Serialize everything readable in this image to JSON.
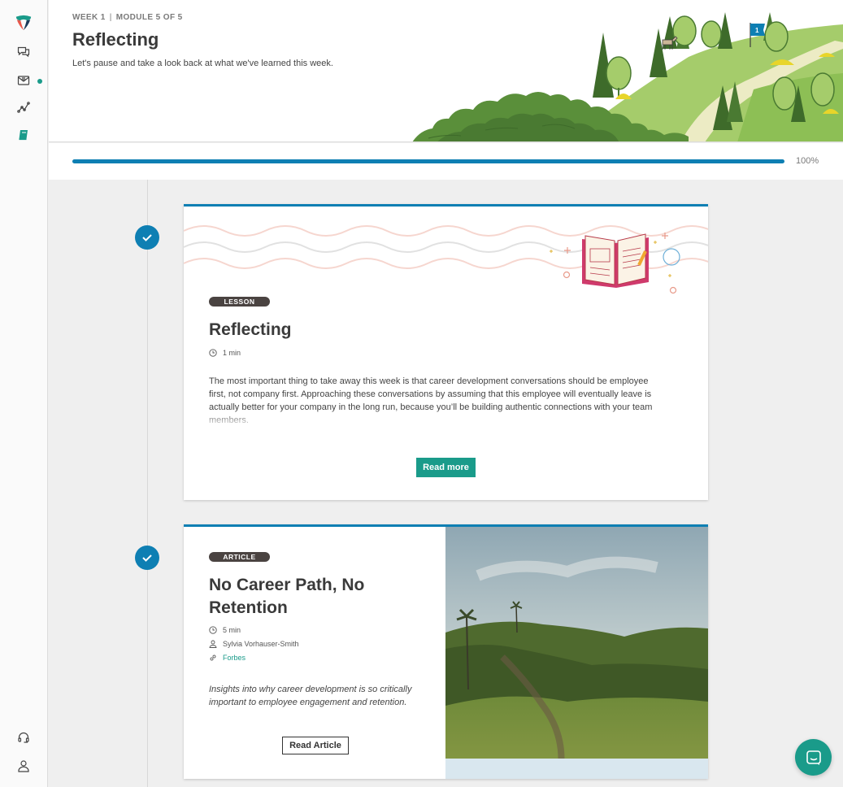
{
  "sidebar": {
    "icons": [
      "logo-icon",
      "chat-bubbles-icon",
      "inbox-icon",
      "analytics-icon",
      "book-icon",
      "headset-icon",
      "user-icon"
    ],
    "accent_color": "#1a9b8a"
  },
  "header": {
    "week": "WEEK 1",
    "separator": "|",
    "module": "MODULE 5 OF 5",
    "title": "Reflecting",
    "subtitle": "Let's pause and take a look back at what we've learned this week.",
    "flag_number": "1"
  },
  "progress": {
    "value": 1.0,
    "label": "100%",
    "color": "#0e7fb3"
  },
  "cards": [
    {
      "type_label": "LESSON",
      "title": "Reflecting",
      "duration": "1 min",
      "excerpt": "The most important thing to take away this week is that career development conversations should be employee first, not company first. Approaching these conversations by assuming that this employee will eventually leave is actually better for your company in the long run, because you’ll be building authentic connections with your team members.",
      "button": "Read more",
      "completed": true
    },
    {
      "type_label": "ARTICLE",
      "title": "No Career Path, No Retention",
      "duration": "5 min",
      "author": "Sylvia Vorhauser-Smith",
      "source": "Forbes",
      "summary": "Insights into why career development is so critically important to employee engagement and retention.",
      "button": "Read Article",
      "completed": true
    }
  ]
}
